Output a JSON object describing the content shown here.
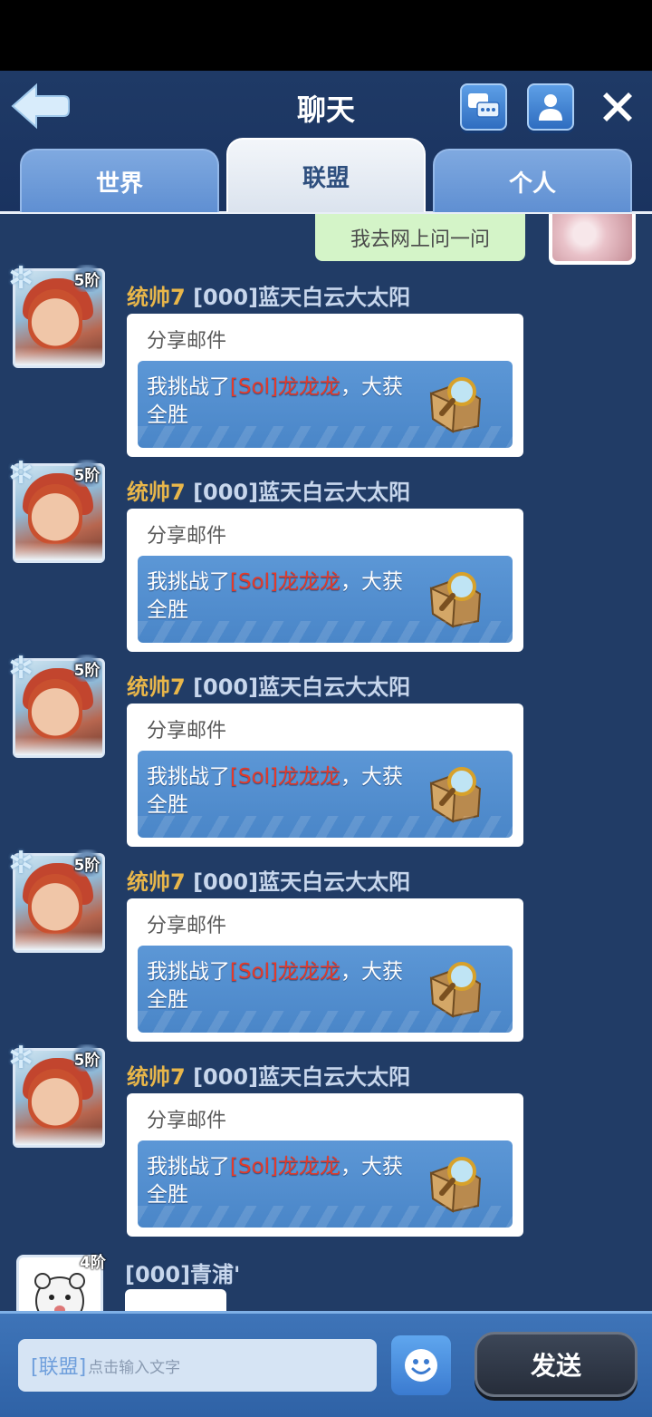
{
  "header": {
    "title": "聊天",
    "tabs": [
      {
        "label": "世界",
        "active": false
      },
      {
        "label": "联盟",
        "active": true
      },
      {
        "label": "个人",
        "active": false
      }
    ]
  },
  "own_message": {
    "text": "我去网上问一问"
  },
  "messages": [
    {
      "rank": "5阶",
      "title": "统帅7",
      "guild_name": "[000]蓝天白云大太阳",
      "card_label": "分享邮件",
      "mail_prefix": "我挑战了",
      "mail_highlight": "[Sol]龙龙龙",
      "mail_suffix": "，大获全胜"
    },
    {
      "rank": "5阶",
      "title": "统帅7",
      "guild_name": "[000]蓝天白云大太阳",
      "card_label": "分享邮件",
      "mail_prefix": "我挑战了",
      "mail_highlight": "[Sol]龙龙龙",
      "mail_suffix": "，大获全胜"
    },
    {
      "rank": "5阶",
      "title": "统帅7",
      "guild_name": "[000]蓝天白云大太阳",
      "card_label": "分享邮件",
      "mail_prefix": "我挑战了",
      "mail_highlight": "[Sol]龙龙龙",
      "mail_suffix": "，大获全胜"
    },
    {
      "rank": "5阶",
      "title": "统帅7",
      "guild_name": "[000]蓝天白云大太阳",
      "card_label": "分享邮件",
      "mail_prefix": "我挑战了",
      "mail_highlight": "[Sol]龙龙龙",
      "mail_suffix": "，大获全胜"
    },
    {
      "rank": "5阶",
      "title": "统帅7",
      "guild_name": "[000]蓝天白云大太阳",
      "card_label": "分享邮件",
      "mail_prefix": "我挑战了",
      "mail_highlight": "[Sol]龙龙龙",
      "mail_suffix": "，大获全胜"
    }
  ],
  "last_message": {
    "rank": "4阶",
    "sender": "[000]青浦'"
  },
  "input": {
    "prefix": "[联盟]",
    "placeholder": "点击输入文字"
  },
  "send_label": "发送",
  "colors": {
    "accent": "#e8b64a",
    "highlight": "#e33a2a",
    "chat_bg": "#213c66"
  },
  "icons": [
    "back-arrow-icon",
    "chat-bubbles-icon",
    "person-icon",
    "close-icon",
    "magnifier-folder-icon",
    "smiley-icon"
  ]
}
